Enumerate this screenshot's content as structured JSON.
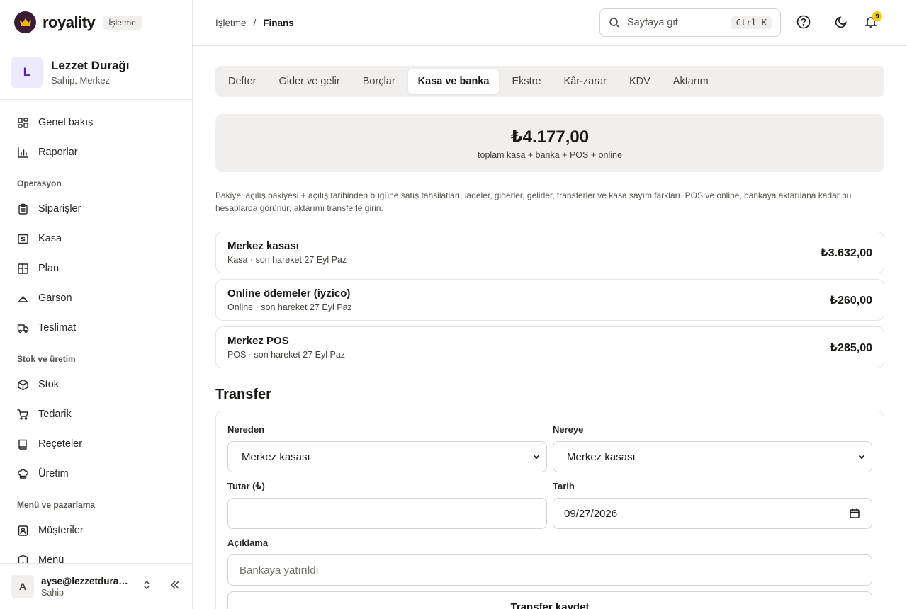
{
  "brand": {
    "name": "royality",
    "badge": "İşletme"
  },
  "org": {
    "initial": "L",
    "name": "Lezzet Durağı",
    "role": "Sahip, Merkez"
  },
  "nav": {
    "top": [
      {
        "label": "Genel bakış",
        "icon": "dashboard-icon"
      },
      {
        "label": "Raporlar",
        "icon": "chart-icon"
      }
    ],
    "groups": [
      {
        "title": "Operasyon",
        "items": [
          {
            "label": "Siparişler",
            "icon": "clipboard-icon"
          },
          {
            "label": "Kasa",
            "icon": "cash-register-icon"
          },
          {
            "label": "Plan",
            "icon": "floor-plan-icon"
          },
          {
            "label": "Garson",
            "icon": "waiter-icon"
          },
          {
            "label": "Teslimat",
            "icon": "truck-icon"
          }
        ]
      },
      {
        "title": "Stok ve üretim",
        "items": [
          {
            "label": "Stok",
            "icon": "box-icon"
          },
          {
            "label": "Tedarik",
            "icon": "cart-icon"
          },
          {
            "label": "Reçeteler",
            "icon": "book-icon"
          },
          {
            "label": "Üretim",
            "icon": "chef-hat-icon"
          }
        ]
      },
      {
        "title": "Menü ve pazarlama",
        "items": [
          {
            "label": "Müşteriler",
            "icon": "contact-icon"
          },
          {
            "label": "Menü",
            "icon": "menu-icon"
          }
        ]
      }
    ]
  },
  "user": {
    "initial": "A",
    "email": "ayse@lezzetduragi.com",
    "role": "Sahip"
  },
  "breadcrumb": {
    "root": "İşletme",
    "sep": "/",
    "current": "Finans"
  },
  "search": {
    "placeholder": "Sayfaya git",
    "shortcut": "Ctrl K"
  },
  "notifications": {
    "count": "9"
  },
  "tabs": [
    "Defter",
    "Gider ve gelir",
    "Borçlar",
    "Kasa ve banka",
    "Ekstre",
    "Kâr-zarar",
    "KDV",
    "Aktarım"
  ],
  "active_tab": "Kasa ve banka",
  "summary": {
    "total": "₺4.177,00",
    "caption": "toplam kasa + banka + POS + online"
  },
  "note": "Bakiye: açılış bakiyesi + açılış tarihinden bugüne satış tahsilatları, iadeler, giderler, gelirler, transferler ve kasa sayım farkları. POS ve online, bankaya aktarılana kadar bu hesaplarda görünür; aktarımı transferle girin.",
  "accounts": [
    {
      "name": "Merkez kasası",
      "sub": "Kasa · son hareket 27 Eyl Paz",
      "amount": "₺3.632,00"
    },
    {
      "name": "Online ödemeler (iyzico)",
      "sub": "Online · son hareket 27 Eyl Paz",
      "amount": "₺260,00"
    },
    {
      "name": "Merkez POS",
      "sub": "POS · son hareket 27 Eyl Paz",
      "amount": "₺285,00"
    }
  ],
  "transfer": {
    "title": "Transfer",
    "from_label": "Nereden",
    "from_value": "Merkez kasası",
    "to_label": "Nereye",
    "to_value": "Merkez kasası",
    "amount_label": "Tutar (₺)",
    "amount_value": "",
    "date_label": "Tarih",
    "date_value": "09/27/2026",
    "desc_label": "Açıklama",
    "desc_placeholder": "Bankaya yatırıldı",
    "submit": "Transfer kaydet"
  },
  "colors": {
    "accent": "#3b1d33",
    "badge": "#facc15",
    "org_avatar_bg": "#ede9fe"
  }
}
